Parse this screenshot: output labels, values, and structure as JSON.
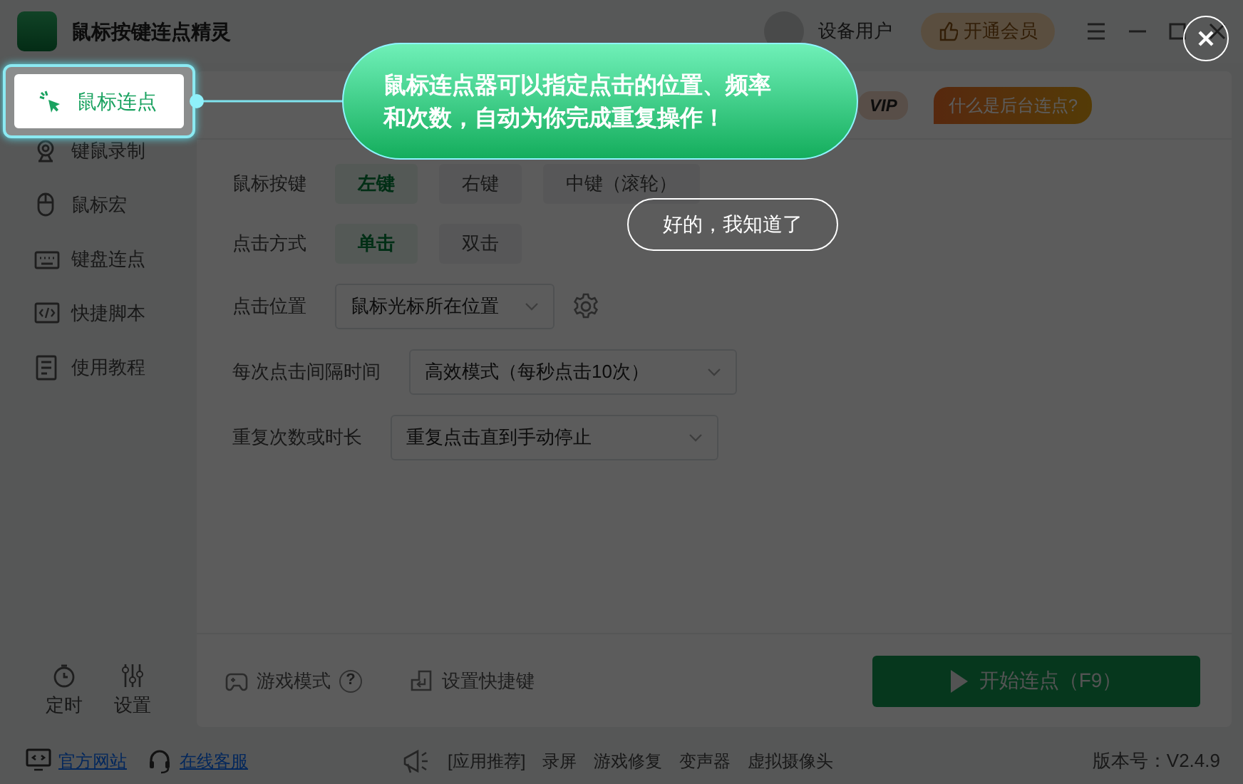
{
  "window": {
    "title": "鼠标按键连点精灵"
  },
  "header": {
    "user": "设备用户",
    "vip_button": "开通会员"
  },
  "sidebar": {
    "items": [
      {
        "label": "鼠标连点",
        "selected": true
      },
      {
        "label": "键鼠录制",
        "selected": false
      },
      {
        "label": "鼠标宏",
        "selected": false
      },
      {
        "label": "键盘连点",
        "selected": false
      },
      {
        "label": "快捷脚本",
        "selected": false
      },
      {
        "label": "使用教程",
        "selected": false
      }
    ],
    "bottom": [
      {
        "label": "定时"
      },
      {
        "label": "设置"
      }
    ]
  },
  "main": {
    "badges": [
      {
        "label": "VIP"
      },
      {
        "label": "什么是后台连点?"
      }
    ],
    "form": [
      {
        "kind": "options",
        "label": "鼠标按键",
        "options": [
          {
            "label": "左键",
            "selected": true
          },
          {
            "label": "右键",
            "selected": false
          },
          {
            "label": "中键（滚轮）",
            "selected": false
          }
        ]
      },
      {
        "kind": "options",
        "label": "点击方式",
        "options": [
          {
            "label": "单击",
            "selected": true
          },
          {
            "label": "双击",
            "selected": false
          }
        ]
      },
      {
        "kind": "select",
        "label": "点击位置",
        "value": "鼠标光标所在位置",
        "gear": true
      },
      {
        "kind": "select",
        "label": "每次点击间隔时间",
        "value": "高效模式（每秒点击10次）",
        "gear": false
      },
      {
        "kind": "select",
        "label": "重复次数或时长",
        "value": "重复点击直到手动停止",
        "gear": false
      }
    ],
    "game_mode": {
      "label": "游戏模式",
      "help": "?"
    },
    "hotkey": "设置快捷键",
    "start_button": "开始连点（F9）"
  },
  "status_bar": {
    "links": [
      {
        "label": "官方网站",
        "kind": "website"
      },
      {
        "label": "在线客服",
        "kind": "support"
      }
    ],
    "recommend_label": "[应用推荐]",
    "apps": [
      "录屏",
      "游戏修复",
      "变声器",
      "虚拟摄像头"
    ],
    "version": "版本号：V2.4.9"
  },
  "guide": {
    "message": "鼠标连点器可以指定点击的位置、频率和次数，自动为你完成重复操作！",
    "confirm": "好的，我知道了"
  }
}
